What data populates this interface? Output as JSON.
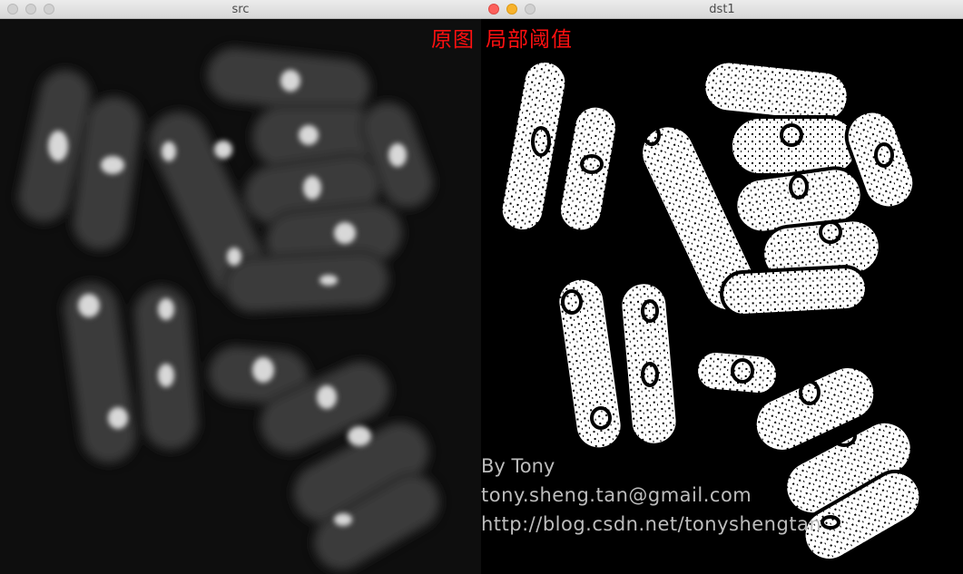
{
  "windows": {
    "src": {
      "title": "src"
    },
    "dst": {
      "title": "dst1"
    }
  },
  "overlay": {
    "label_src": "原图",
    "label_dst": "局部阈值",
    "label_color": "#ff1010"
  },
  "credits": {
    "name": "By Tony",
    "email": "tony.sheng.tan@gmail.com",
    "url": "http://blog.csdn.net/tonyshengtan"
  },
  "colors": {
    "close_active": "#fc605b",
    "minimize_active": "#f7b22c",
    "traffic_inactive": "#d0d0d0"
  },
  "icons": [
    "close-button-icon",
    "minimize-button-icon",
    "maximize-button-icon"
  ]
}
